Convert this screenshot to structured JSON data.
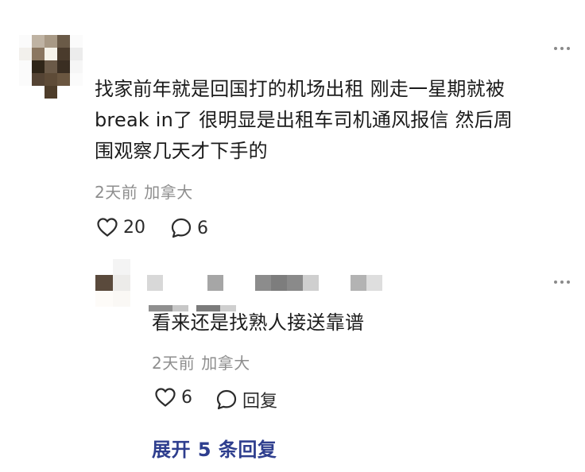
{
  "comment": {
    "text": "找家前年就是回国打的机场出租 刚走一星期就被\nbreak in了 很明显是出租车司机通风报信 然后周\n围观察几天才下手的",
    "time": "2天前",
    "location": "加拿大",
    "like_count": "20",
    "reply_count": "6"
  },
  "reply": {
    "text": "看来还是找熟人接送靠谱",
    "time": "2天前",
    "location": "加拿大",
    "like_count": "6",
    "reply_label": "回复"
  },
  "expand": {
    "label": "展开 5 条回复"
  },
  "icons": {
    "more": "more-horizontal-icon",
    "like": "heart-outline-icon",
    "comment": "comment-bubble-icon"
  },
  "colors": {
    "text": "#1c1c1c",
    "meta": "#8e8e8e",
    "link": "#2e3e8e"
  }
}
